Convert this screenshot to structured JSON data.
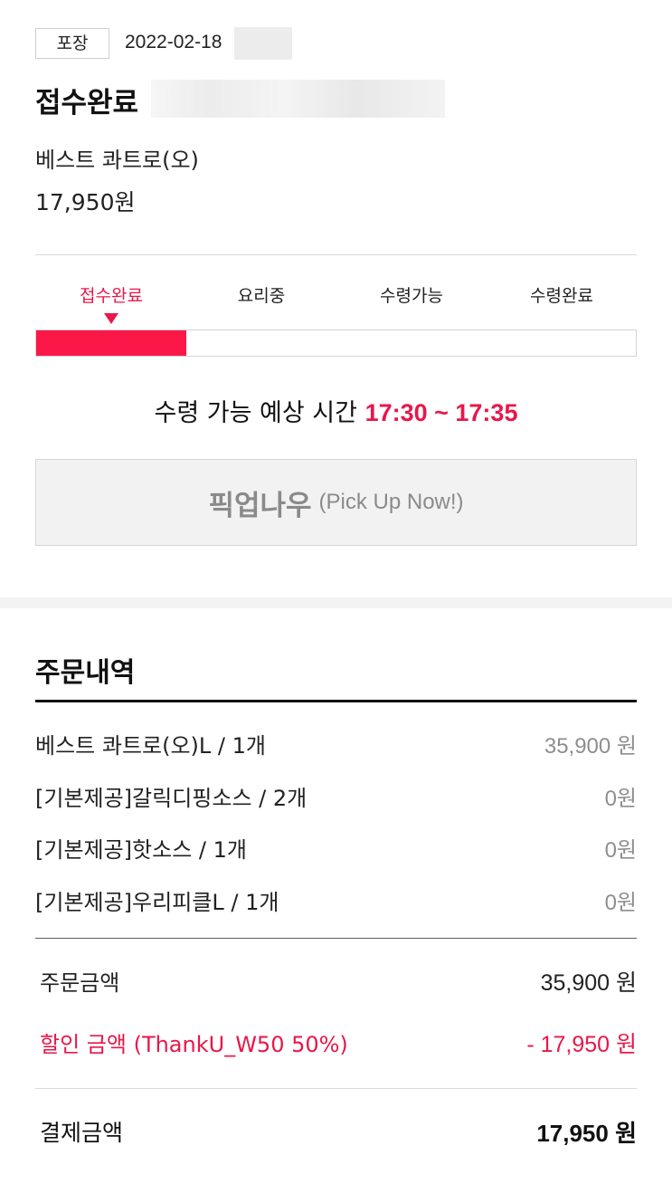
{
  "header": {
    "order_type": "포장",
    "order_date": "2022-02-18",
    "status_title": "접수완료",
    "store_name": "베스트 콰트로(오)",
    "store_price": "17,950원"
  },
  "progress": {
    "steps": [
      "접수완료",
      "요리중",
      "수령가능",
      "수령완료"
    ],
    "current_step_index": 0,
    "fill_fraction": 0.25,
    "accent_color": "#fb1848"
  },
  "eta": {
    "label": "수령 가능 예상 시간",
    "time": "17:30 ~ 17:35"
  },
  "pickup_button": {
    "label": "픽업나우",
    "sub_label": "(Pick Up Now!)"
  },
  "order_details": {
    "heading": "주문내역",
    "items": [
      {
        "name": "베스트 콰트로(오)L / 1개",
        "price": "35,900 원"
      },
      {
        "name": "[기본제공]갈릭디핑소스 / 2개",
        "price": "0원"
      },
      {
        "name": "[기본제공]핫소스 / 1개",
        "price": "0원"
      },
      {
        "name": "[기본제공]우리피클L / 1개",
        "price": "0원"
      }
    ],
    "order_amount_label": "주문금액",
    "order_amount_value": "35,900 원",
    "discount_label": "할인 금액 (ThankU_W50 50%)",
    "discount_value": "- 17,950 원",
    "payment_label": "결제금액",
    "payment_value": "17,950 원"
  },
  "colors": {
    "accent": "#e8174a",
    "text": "#1a1a1a",
    "muted": "#8e8e8e"
  }
}
